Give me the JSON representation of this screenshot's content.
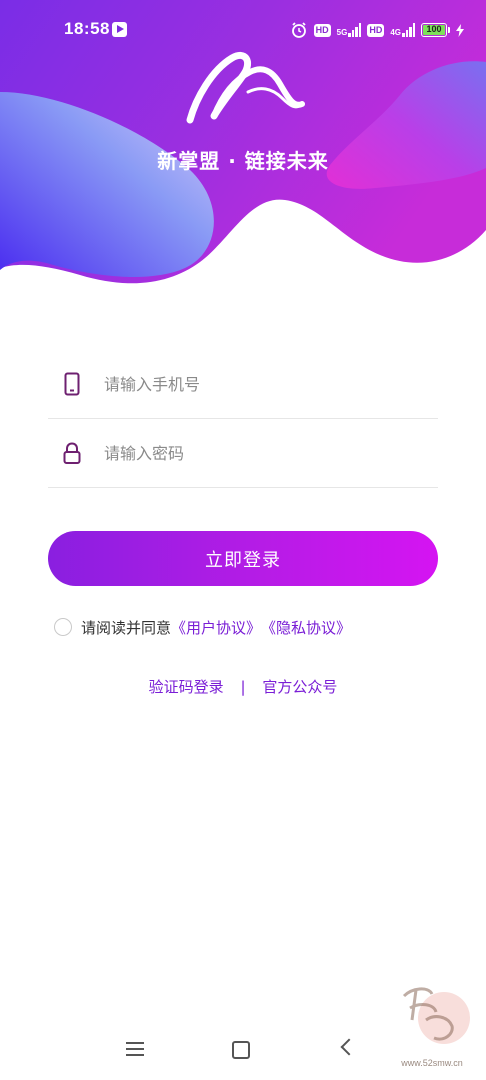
{
  "status_bar": {
    "time": "18:58",
    "hd1": "HD",
    "net1": "5G",
    "hd2": "HD",
    "net2": "4G",
    "battery": "100"
  },
  "header": {
    "slogan": "新掌盟 · 链接未来"
  },
  "form": {
    "phone_placeholder": "请输入手机号",
    "password_placeholder": "请输入密码",
    "login_button": "立即登录"
  },
  "agreement": {
    "prefix": "请阅读并同意",
    "user_agreement": "《用户协议》",
    "privacy_policy": "《隐私协议》"
  },
  "alt_links": {
    "sms_login": "验证码登录",
    "separator": "|",
    "official_account": "官方公众号"
  },
  "watermark": {
    "url": "www.52smw.cn"
  },
  "colors": {
    "accent": "#8a1fe0",
    "gradient_end": "#d514f2",
    "link": "#7a1ed6"
  }
}
